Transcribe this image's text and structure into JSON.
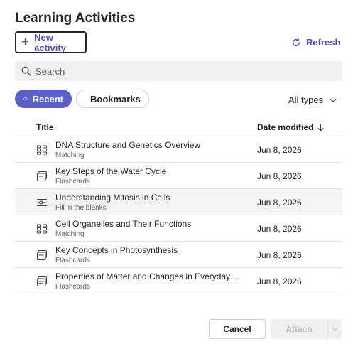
{
  "header": {
    "title": "Learning Activities"
  },
  "toolbar": {
    "new_label": "New activity",
    "refresh_label": "Refresh"
  },
  "search": {
    "placeholder": "Search"
  },
  "filters": {
    "recent_label": "Recent",
    "bookmarks_label": "Bookmarks",
    "type_filter": "All types"
  },
  "table": {
    "columns": {
      "title": "Title",
      "date": "Date modified"
    },
    "rows": [
      {
        "name": "DNA Structure and Genetics Overview",
        "type": "Matching",
        "date": "Jun 8, 2026",
        "icon": "matching-icon"
      },
      {
        "name": "Key Steps of the Water Cycle",
        "type": "Flashcards",
        "date": "Jun 8, 2026",
        "icon": "flashcards-icon"
      },
      {
        "name": "Understanding Mitosis in Cells",
        "type": "Fill in the blanks",
        "date": "Jun 8, 2026",
        "icon": "fill-blanks-icon"
      },
      {
        "name": "Cell Organelles and Their Functions",
        "type": "Matching",
        "date": "Jun 8, 2026",
        "icon": "matching-icon"
      },
      {
        "name": "Key Concepts in Photosynthesis",
        "type": "Flashcards",
        "date": "Jun 8, 2026",
        "icon": "flashcards-icon"
      },
      {
        "name": "Properties of Matter and Changes in Everyday ...",
        "type": "Flashcards",
        "date": "Jun 8, 2026",
        "icon": "flashcards-icon"
      }
    ]
  },
  "footer": {
    "cancel_label": "Cancel",
    "attach_label": "Attach"
  },
  "colors": {
    "accent": "#5b5fc7",
    "link": "#4f52b2"
  }
}
